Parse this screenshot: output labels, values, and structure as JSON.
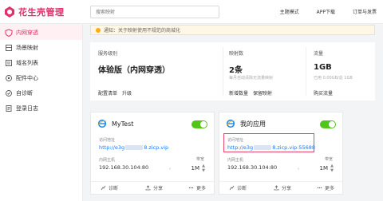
{
  "header": {
    "logo_text": "花生壳管理",
    "search_placeholder": "搜索映射",
    "nav": [
      "主题模式",
      "APP下载",
      "订单与发票"
    ]
  },
  "sidebar": {
    "items": [
      {
        "label": "内网穿透",
        "active": true,
        "icon": "shield-icon"
      },
      {
        "label": "场景映射",
        "active": false,
        "icon": "scene-icon"
      },
      {
        "label": "域名列表",
        "active": false,
        "icon": "domain-icon"
      },
      {
        "label": "配件中心",
        "active": false,
        "icon": "gear-icon"
      },
      {
        "label": "自诊断",
        "active": false,
        "icon": "diagnose-icon"
      },
      {
        "label": "登录日志",
        "active": false,
        "icon": "log-icon"
      }
    ]
  },
  "notice": {
    "text": "通知：关于映射使用不规范的商城化"
  },
  "stats": {
    "service": {
      "label": "服务级别",
      "value": "体验版（内网穿透）",
      "links": [
        "配置清单",
        "升级"
      ]
    },
    "mappings": {
      "label": "映射数",
      "value": "2条",
      "sub": "每月自动清除无流量映射",
      "links": [
        "新增数量",
        "保留映射"
      ]
    },
    "traffic": {
      "label": "流量",
      "value": "1GB",
      "sub": "已用 0.00GB/总 1GB",
      "links": [
        "购买流量"
      ]
    }
  },
  "cards": [
    {
      "name": "MyTest",
      "access_label": "访问地址",
      "url_prefix": "http://e3g",
      "url_suffix": "8.zicp.vip",
      "host_label": "内网主机",
      "host": "192.168.30.104:80",
      "bw_label": "带宽",
      "bw": "1M",
      "actions": [
        "诊断",
        "分享",
        "更多"
      ],
      "enabled": true,
      "highlighted": false
    },
    {
      "name": "我的应用",
      "access_label": "访问地址",
      "url_prefix": "http://e3g",
      "url_suffix": "8.zicp.vip:55688",
      "host_label": "内网主机",
      "host": "192.168.30.104:80",
      "bw_label": "带宽",
      "bw": "1M",
      "actions": [
        "诊断",
        "分享",
        "更多"
      ],
      "enabled": true,
      "highlighted": true
    }
  ],
  "colors": {
    "brand": "#e1306c",
    "link": "#1677ff",
    "toggle_on": "#52c41a",
    "highlight": "#e8486a"
  }
}
